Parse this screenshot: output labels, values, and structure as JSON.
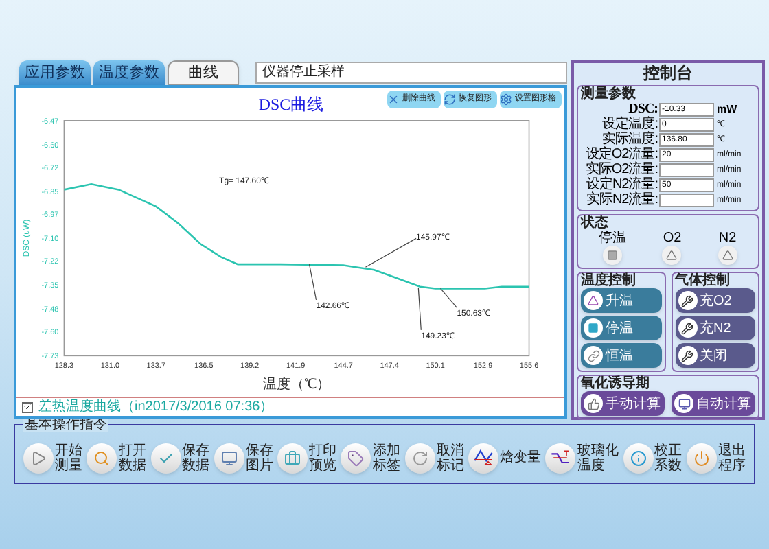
{
  "tabs": [
    {
      "label": "应用参数",
      "selected": false
    },
    {
      "label": "温度参数",
      "selected": false
    },
    {
      "label": "曲线",
      "selected": true
    }
  ],
  "status_field": {
    "value": "仪器停止采样"
  },
  "chart_panel": {
    "tools": [
      "删除曲线",
      "恢复图形",
      "设置图形格"
    ],
    "chart_data": {
      "type": "line",
      "title": "DSC曲线",
      "xlabel": "温度（℃）",
      "ylabel": "DSC (uW)",
      "x": [
        128.3,
        129.9,
        131.5,
        133.7,
        135.0,
        136.3,
        137.5,
        138.5,
        141.0,
        144.7,
        146.5,
        148.0,
        149.2,
        150.1,
        153.0,
        154.0,
        155.6
      ],
      "series": [
        {
          "name": "差热温度曲线",
          "color": "#2bc4b0",
          "values": [
            -6.84,
            -6.81,
            -6.84,
            -6.93,
            -7.02,
            -7.13,
            -7.2,
            -7.24,
            -7.24,
            -7.245,
            -7.27,
            -7.32,
            -7.36,
            -7.37,
            -7.37,
            -7.36,
            -7.36
          ]
        }
      ],
      "xlim": [
        128.3,
        155.6
      ],
      "ylim": [
        -7.73,
        -6.47
      ],
      "xticks": [
        {
          "value": 128.3,
          "label": "128.3"
        },
        {
          "value": 131.0,
          "label": "131.0"
        },
        {
          "value": 133.7,
          "label": "133.7"
        },
        {
          "value": 136.5,
          "label": "136.5"
        },
        {
          "value": 139.2,
          "label": "139.2"
        },
        {
          "value": 141.9,
          "label": "141.9"
        },
        {
          "value": 144.7,
          "label": "144.7"
        },
        {
          "value": 147.4,
          "label": "147.4"
        },
        {
          "value": 150.1,
          "label": "150.1"
        },
        {
          "value": 152.9,
          "label": "152.9"
        },
        {
          "value": 155.6,
          "label": "155.6"
        }
      ],
      "yticks": [
        {
          "value": -6.47,
          "label": "-6.47"
        },
        {
          "value": -6.6,
          "label": "-6.60"
        },
        {
          "value": -6.72,
          "label": "-6.72"
        },
        {
          "value": -6.85,
          "label": "-6.85"
        },
        {
          "value": -6.97,
          "label": "-6.97"
        },
        {
          "value": -7.1,
          "label": "-7.10"
        },
        {
          "value": -7.22,
          "label": "-7.22"
        },
        {
          "value": -7.35,
          "label": "-7.35"
        },
        {
          "value": -7.48,
          "label": "-7.48"
        },
        {
          "value": -7.6,
          "label": "-7.60"
        },
        {
          "value": -7.73,
          "label": "-7.73"
        }
      ],
      "annotations": [
        "Tg= 147.60℃",
        {
          "text": "145.97℃",
          "x": 146.0,
          "y": -7.255
        },
        {
          "text": "142.66℃",
          "x": 142.7,
          "y": -7.24
        },
        {
          "text": "149.23℃",
          "x": 149.1,
          "y": -7.365
        },
        {
          "text": "150.63℃",
          "x": 150.4,
          "y": -7.37
        }
      ]
    },
    "legend": {
      "suffix": "（in2017/3/2016 07:36）",
      "checked": true
    }
  },
  "console": {
    "title": "控制台",
    "measure": {
      "title": "测量参数",
      "fields": [
        {
          "label": "DSC:",
          "value": "-10.33",
          "unit": "mW"
        },
        {
          "label": "设定温度:",
          "value": "0",
          "unit": "℃"
        },
        {
          "label": "实际温度:",
          "value": "136.80",
          "unit": "℃"
        },
        {
          "label": "设定O2流量:",
          "value": "20",
          "unit": "ml/min"
        },
        {
          "label": "实际O2流量:",
          "unit": "ml/min"
        },
        {
          "label": "设定N2流量:",
          "value": "50",
          "unit": "ml/min"
        },
        {
          "label": "实际N2流量:",
          "unit": "ml/min"
        }
      ]
    },
    "status": {
      "title": "状态",
      "items": [
        "停温",
        "O2",
        "N2"
      ]
    },
    "temp_control": {
      "title": "温度控制",
      "buttons": [
        "升温",
        "停温",
        "恒温"
      ]
    },
    "gas_control": {
      "title": "气体控制",
      "buttons": [
        "充O2",
        "充N2",
        "关闭"
      ]
    },
    "oxidation": {
      "title": "氧化诱导期",
      "buttons": [
        "手动计算",
        "自动计算"
      ]
    }
  },
  "commands": {
    "title": "基本操作指令",
    "buttons": [
      {
        "lines": [
          "开始",
          "测量"
        ]
      },
      {
        "lines": [
          "打开",
          "数据"
        ]
      },
      {
        "lines": [
          "保存",
          "数据"
        ]
      },
      {
        "lines": [
          "保存",
          "图片"
        ]
      },
      {
        "lines": [
          "打印",
          "预览"
        ]
      },
      {
        "lines": [
          "添加",
          "标签"
        ]
      },
      {
        "lines": [
          "取消",
          "标记"
        ]
      },
      {
        "lines": [
          "焓变量"
        ]
      },
      {
        "lines": [
          "玻璃化",
          "温度"
        ]
      },
      {
        "lines": [
          "校正",
          "系数"
        ]
      },
      {
        "lines": [
          "退出",
          "程序"
        ]
      }
    ]
  }
}
